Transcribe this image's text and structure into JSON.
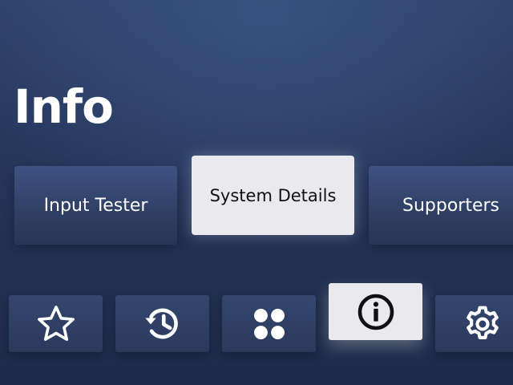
{
  "page": {
    "title": "Info"
  },
  "cards": [
    {
      "label": "Input Tester"
    },
    {
      "label": "System Details",
      "focused": true
    },
    {
      "label": "Supporters"
    }
  ],
  "nav": [
    {
      "icon": "star-icon"
    },
    {
      "icon": "history-icon"
    },
    {
      "icon": "apps-icon"
    },
    {
      "icon": "info-icon",
      "focused": true
    },
    {
      "icon": "gear-icon"
    }
  ],
  "colors": {
    "background": "#25365a",
    "card": "#3a4d7c",
    "focused": "#e9e9ee",
    "text": "#ffffff"
  }
}
